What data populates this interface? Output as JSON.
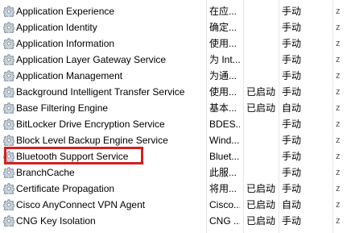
{
  "services": [
    {
      "name": "Application Experience",
      "desc": "在应...",
      "status": "",
      "startup": "手动",
      "edge": "z"
    },
    {
      "name": "Application Identity",
      "desc": "确定...",
      "status": "",
      "startup": "手动",
      "edge": "z"
    },
    {
      "name": "Application Information",
      "desc": "使用...",
      "status": "",
      "startup": "手动",
      "edge": "z"
    },
    {
      "name": "Application Layer Gateway Service",
      "desc": "为 Int...",
      "status": "",
      "startup": "手动",
      "edge": "z"
    },
    {
      "name": "Application Management",
      "desc": "为通...",
      "status": "",
      "startup": "手动",
      "edge": "z"
    },
    {
      "name": "Background Intelligent Transfer Service",
      "desc": "使用...",
      "status": "已启动",
      "startup": "手动",
      "edge": "z"
    },
    {
      "name": "Base Filtering Engine",
      "desc": "基本...",
      "status": "已启动",
      "startup": "自动",
      "edge": "z"
    },
    {
      "name": "BitLocker Drive Encryption Service",
      "desc": "BDES...",
      "status": "",
      "startup": "手动",
      "edge": "z"
    },
    {
      "name": "Block Level Backup Engine Service",
      "desc": "Wind...",
      "status": "",
      "startup": "手动",
      "edge": "z"
    },
    {
      "name": "Bluetooth Support Service",
      "desc": "Bluet...",
      "status": "",
      "startup": "手动",
      "edge": "z"
    },
    {
      "name": "BranchCache",
      "desc": "此服...",
      "status": "",
      "startup": "手动",
      "edge": "z"
    },
    {
      "name": "Certificate Propagation",
      "desc": "将用...",
      "status": "已启动",
      "startup": "手动",
      "edge": "z"
    },
    {
      "name": "Cisco AnyConnect VPN Agent",
      "desc": "Cisco...",
      "status": "已启动",
      "startup": "自动",
      "edge": "z"
    },
    {
      "name": "CNG Key Isolation",
      "desc": "CNG ...",
      "status": "已启动",
      "startup": "手动",
      "edge": "z"
    }
  ],
  "colors": {
    "highlight_border": "#d41f1f",
    "gear_fill": "#c9d4de",
    "gear_stroke": "#6f7f8e"
  },
  "icons": {
    "service": "gear-icon"
  }
}
